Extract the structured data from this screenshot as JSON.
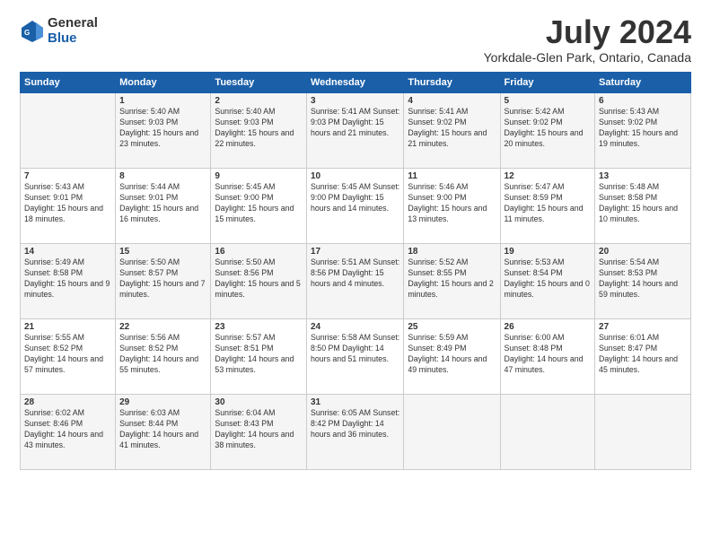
{
  "header": {
    "logo_general": "General",
    "logo_blue": "Blue",
    "month_title": "July 2024",
    "location": "Yorkdale-Glen Park, Ontario, Canada"
  },
  "days_of_week": [
    "Sunday",
    "Monday",
    "Tuesday",
    "Wednesday",
    "Thursday",
    "Friday",
    "Saturday"
  ],
  "weeks": [
    [
      {
        "day": "",
        "content": ""
      },
      {
        "day": "1",
        "content": "Sunrise: 5:40 AM\nSunset: 9:03 PM\nDaylight: 15 hours\nand 23 minutes."
      },
      {
        "day": "2",
        "content": "Sunrise: 5:40 AM\nSunset: 9:03 PM\nDaylight: 15 hours\nand 22 minutes."
      },
      {
        "day": "3",
        "content": "Sunrise: 5:41 AM\nSunset: 9:03 PM\nDaylight: 15 hours\nand 21 minutes."
      },
      {
        "day": "4",
        "content": "Sunrise: 5:41 AM\nSunset: 9:02 PM\nDaylight: 15 hours\nand 21 minutes."
      },
      {
        "day": "5",
        "content": "Sunrise: 5:42 AM\nSunset: 9:02 PM\nDaylight: 15 hours\nand 20 minutes."
      },
      {
        "day": "6",
        "content": "Sunrise: 5:43 AM\nSunset: 9:02 PM\nDaylight: 15 hours\nand 19 minutes."
      }
    ],
    [
      {
        "day": "7",
        "content": "Sunrise: 5:43 AM\nSunset: 9:01 PM\nDaylight: 15 hours\nand 18 minutes."
      },
      {
        "day": "8",
        "content": "Sunrise: 5:44 AM\nSunset: 9:01 PM\nDaylight: 15 hours\nand 16 minutes."
      },
      {
        "day": "9",
        "content": "Sunrise: 5:45 AM\nSunset: 9:00 PM\nDaylight: 15 hours\nand 15 minutes."
      },
      {
        "day": "10",
        "content": "Sunrise: 5:45 AM\nSunset: 9:00 PM\nDaylight: 15 hours\nand 14 minutes."
      },
      {
        "day": "11",
        "content": "Sunrise: 5:46 AM\nSunset: 9:00 PM\nDaylight: 15 hours\nand 13 minutes."
      },
      {
        "day": "12",
        "content": "Sunrise: 5:47 AM\nSunset: 8:59 PM\nDaylight: 15 hours\nand 11 minutes."
      },
      {
        "day": "13",
        "content": "Sunrise: 5:48 AM\nSunset: 8:58 PM\nDaylight: 15 hours\nand 10 minutes."
      }
    ],
    [
      {
        "day": "14",
        "content": "Sunrise: 5:49 AM\nSunset: 8:58 PM\nDaylight: 15 hours\nand 9 minutes."
      },
      {
        "day": "15",
        "content": "Sunrise: 5:50 AM\nSunset: 8:57 PM\nDaylight: 15 hours\nand 7 minutes."
      },
      {
        "day": "16",
        "content": "Sunrise: 5:50 AM\nSunset: 8:56 PM\nDaylight: 15 hours\nand 5 minutes."
      },
      {
        "day": "17",
        "content": "Sunrise: 5:51 AM\nSunset: 8:56 PM\nDaylight: 15 hours\nand 4 minutes."
      },
      {
        "day": "18",
        "content": "Sunrise: 5:52 AM\nSunset: 8:55 PM\nDaylight: 15 hours\nand 2 minutes."
      },
      {
        "day": "19",
        "content": "Sunrise: 5:53 AM\nSunset: 8:54 PM\nDaylight: 15 hours\nand 0 minutes."
      },
      {
        "day": "20",
        "content": "Sunrise: 5:54 AM\nSunset: 8:53 PM\nDaylight: 14 hours\nand 59 minutes."
      }
    ],
    [
      {
        "day": "21",
        "content": "Sunrise: 5:55 AM\nSunset: 8:52 PM\nDaylight: 14 hours\nand 57 minutes."
      },
      {
        "day": "22",
        "content": "Sunrise: 5:56 AM\nSunset: 8:52 PM\nDaylight: 14 hours\nand 55 minutes."
      },
      {
        "day": "23",
        "content": "Sunrise: 5:57 AM\nSunset: 8:51 PM\nDaylight: 14 hours\nand 53 minutes."
      },
      {
        "day": "24",
        "content": "Sunrise: 5:58 AM\nSunset: 8:50 PM\nDaylight: 14 hours\nand 51 minutes."
      },
      {
        "day": "25",
        "content": "Sunrise: 5:59 AM\nSunset: 8:49 PM\nDaylight: 14 hours\nand 49 minutes."
      },
      {
        "day": "26",
        "content": "Sunrise: 6:00 AM\nSunset: 8:48 PM\nDaylight: 14 hours\nand 47 minutes."
      },
      {
        "day": "27",
        "content": "Sunrise: 6:01 AM\nSunset: 8:47 PM\nDaylight: 14 hours\nand 45 minutes."
      }
    ],
    [
      {
        "day": "28",
        "content": "Sunrise: 6:02 AM\nSunset: 8:46 PM\nDaylight: 14 hours\nand 43 minutes."
      },
      {
        "day": "29",
        "content": "Sunrise: 6:03 AM\nSunset: 8:44 PM\nDaylight: 14 hours\nand 41 minutes."
      },
      {
        "day": "30",
        "content": "Sunrise: 6:04 AM\nSunset: 8:43 PM\nDaylight: 14 hours\nand 38 minutes."
      },
      {
        "day": "31",
        "content": "Sunrise: 6:05 AM\nSunset: 8:42 PM\nDaylight: 14 hours\nand 36 minutes."
      },
      {
        "day": "",
        "content": ""
      },
      {
        "day": "",
        "content": ""
      },
      {
        "day": "",
        "content": ""
      }
    ]
  ]
}
